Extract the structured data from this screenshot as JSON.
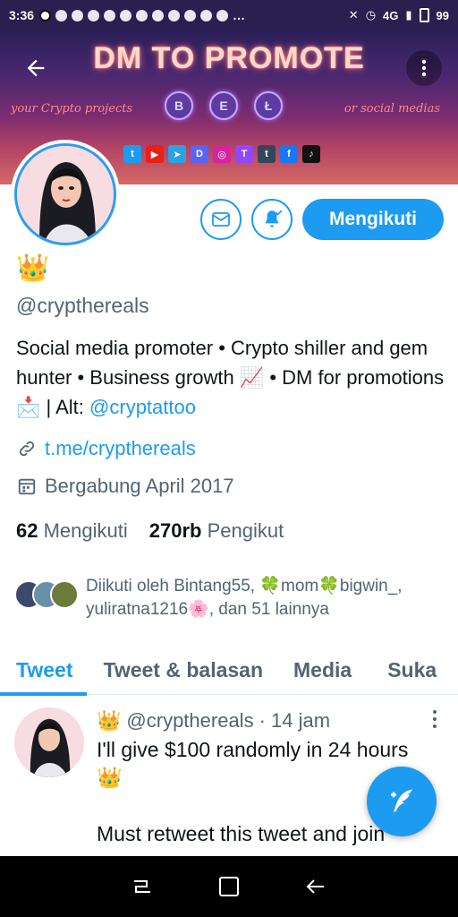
{
  "status_bar": {
    "time": "3:36",
    "network": "4G",
    "battery": "99"
  },
  "banner": {
    "title": "DM TO PROMOTE",
    "left_tagline": "your Crypto projects",
    "right_tagline": "or social medias",
    "coins": [
      "B",
      "E",
      "Ł"
    ],
    "social_icons": [
      {
        "name": "twitter-icon",
        "glyph": "t",
        "color": "#1d9bf0"
      },
      {
        "name": "youtube-icon",
        "glyph": "▶",
        "color": "#e62117"
      },
      {
        "name": "telegram-icon",
        "glyph": "➤",
        "color": "#2aa3e0"
      },
      {
        "name": "discord-icon",
        "glyph": "D",
        "color": "#5865f2"
      },
      {
        "name": "instagram-icon",
        "glyph": "◎",
        "color": "#d6249f"
      },
      {
        "name": "twitch-icon",
        "glyph": "T",
        "color": "#9146ff"
      },
      {
        "name": "tumblr-icon",
        "glyph": "t",
        "color": "#35465c"
      },
      {
        "name": "facebook-icon",
        "glyph": "f",
        "color": "#1877f2"
      },
      {
        "name": "tiktok-icon",
        "glyph": "♪",
        "color": "#111111"
      }
    ]
  },
  "profile": {
    "crown": "👑",
    "handle": "@crypthereals",
    "bio_text": "Social media promoter • Crypto shiller and gem hunter • Business growth 📈 • DM for promotions 📩 | Alt: ",
    "bio_link": "@cryptattoo",
    "website": "t.me/crypthereals",
    "joined": "Bergabung April 2017",
    "following_count": "62",
    "following_label": "Mengikuti",
    "followers_count": "270rb",
    "followers_label": "Pengikut",
    "followed_by": "Diikuti oleh Bintang55, 🍀mom🍀bigwin_, yuliratna1216🌸, dan 51 lainnya"
  },
  "actions": {
    "follow_label": "Mengikuti"
  },
  "tabs": [
    "Tweet",
    "Tweet & balasan",
    "Media",
    "Suka"
  ],
  "tweet": {
    "crown": "👑",
    "handle": "@crypthereals",
    "time": "· 14 jam",
    "text_line1": "I'll give $100 randomly in 24 hours",
    "text_crown": "👑",
    "text_line2": "Must retweet this tweet and join"
  },
  "colors": {
    "accent": "#1d9bf0",
    "muted": "#536471"
  }
}
